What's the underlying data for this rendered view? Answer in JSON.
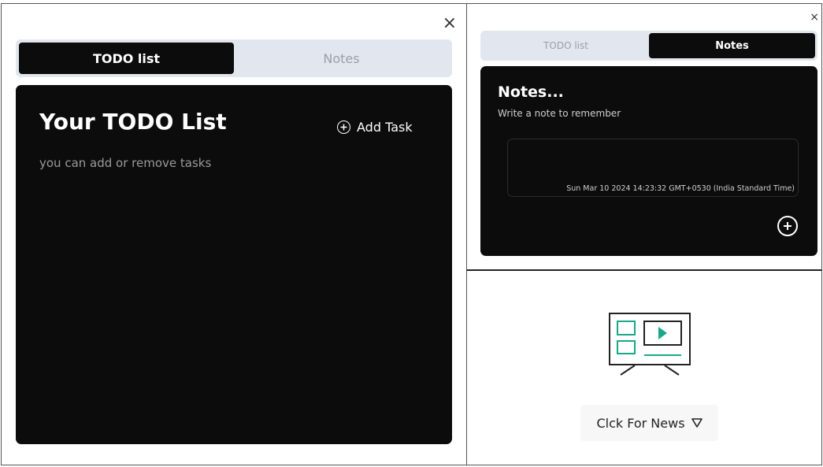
{
  "todo_window": {
    "close_glyph": "×",
    "tabs": [
      {
        "label": "TODO list",
        "active": true
      },
      {
        "label": "Notes",
        "active": false
      }
    ],
    "heading": "Your TODO List",
    "subtitle": "you can add or remove tasks",
    "add_task_label": "Add Task",
    "add_icon": "plus-circle-icon"
  },
  "notes_window": {
    "close_glyph": "×",
    "tabs": [
      {
        "label": "TODO list",
        "active": false
      },
      {
        "label": "Notes",
        "active": true
      }
    ],
    "heading": "Notes...",
    "subtitle": "Write a note to remember",
    "note_timestamp": "Sun Mar 10 2024 14:23:32 GMT+0530 (India Standard Time)",
    "add_icon": "plus-circle-icon"
  },
  "news_window": {
    "icon": "tv-media-icon",
    "button_label": "Clck For News",
    "button_icon": "triangle-down-icon"
  },
  "colors": {
    "panel_bg": "#0c0c0c",
    "tab_bar_bg": "#e2e7ef",
    "accent_green": "#19a888",
    "news_button_bg": "#f7f7f7"
  }
}
